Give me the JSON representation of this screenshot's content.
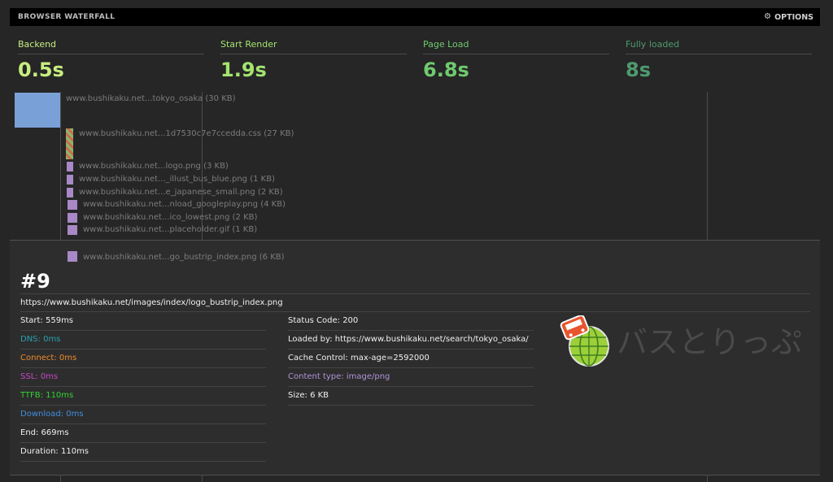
{
  "header": {
    "title": "BROWSER WATERFALL",
    "options_label": "OPTIONS",
    "options_icon": "gear-icon"
  },
  "metrics": [
    {
      "label": "Backend",
      "value": "0.5s",
      "color": "#c7ee7f"
    },
    {
      "label": "Start Render",
      "value": "1.9s",
      "color": "#a3e46f"
    },
    {
      "label": "Page Load",
      "value": "6.8s",
      "color": "#6fca6f"
    },
    {
      "label": "Fully loaded",
      "value": "8s",
      "color": "#4e9a6e"
    }
  ],
  "requests": [
    {
      "label": "www.bushikaku.net...tokyo_osaka (30 KB)",
      "type": "html",
      "color": "#7aa0d8"
    },
    {
      "label": "www.bushikaku.net...1d7530c7e7ccedda.css (27 KB)",
      "type": "css",
      "color": "#8fb56a"
    },
    {
      "label": "www.bushikaku.net...logo.png (3 KB)",
      "type": "image",
      "color": "#a888c6"
    },
    {
      "label": "www.bushikaku.net..._illust_bus_blue.png (1 KB)",
      "type": "image",
      "color": "#a888c6"
    },
    {
      "label": "www.bushikaku.net...e_japanese_small.png (2 KB)",
      "type": "image",
      "color": "#a888c6"
    },
    {
      "label": "www.bushikaku.net...nload_googleplay.png (4 KB)",
      "type": "image",
      "color": "#a888c6"
    },
    {
      "label": "www.bushikaku.net...ico_lowest.png (2 KB)",
      "type": "image",
      "color": "#a888c6"
    },
    {
      "label": "www.bushikaku.net...placeholder.gif (1 KB)",
      "type": "image",
      "color": "#a888c6"
    },
    {
      "label": "www.bushikaku.net...go_bustrip_index.png (6 KB)",
      "type": "image",
      "color": "#a888c6"
    }
  ],
  "detail": {
    "index": "#9",
    "url": "https://www.bushikaku.net/images/index/logo_bustrip_index.png",
    "timing": [
      {
        "text": "Start: 559ms",
        "color": "#f0f0f0"
      },
      {
        "text": "DNS: 0ms",
        "color": "#2aa0b0"
      },
      {
        "text": "Connect: 0ms",
        "color": "#f08a2c"
      },
      {
        "text": "SSL: 0ms",
        "color": "#c648c6"
      },
      {
        "text": "TTFB: 110ms",
        "color": "#32d232"
      },
      {
        "text": "Download: 0ms",
        "color": "#3f8fe0"
      },
      {
        "text": "End: 669ms",
        "color": "#f0f0f0"
      },
      {
        "text": "Duration: 110ms",
        "color": "#f0f0f0"
      }
    ],
    "info": [
      {
        "text": "Status Code: 200",
        "color": "#f0f0f0"
      },
      {
        "text": "Loaded by: https://www.bushikaku.net/search/tokyo_osaka/",
        "color": "#f0f0f0"
      },
      {
        "text": "Cache Control: max-age=2592000",
        "color": "#f0f0f0"
      },
      {
        "text": "Content type: image/png",
        "color": "#b094d8"
      },
      {
        "text": "Size: 6 KB",
        "color": "#f0f0f0"
      }
    ],
    "preview_text": "バスとりっぷ"
  }
}
